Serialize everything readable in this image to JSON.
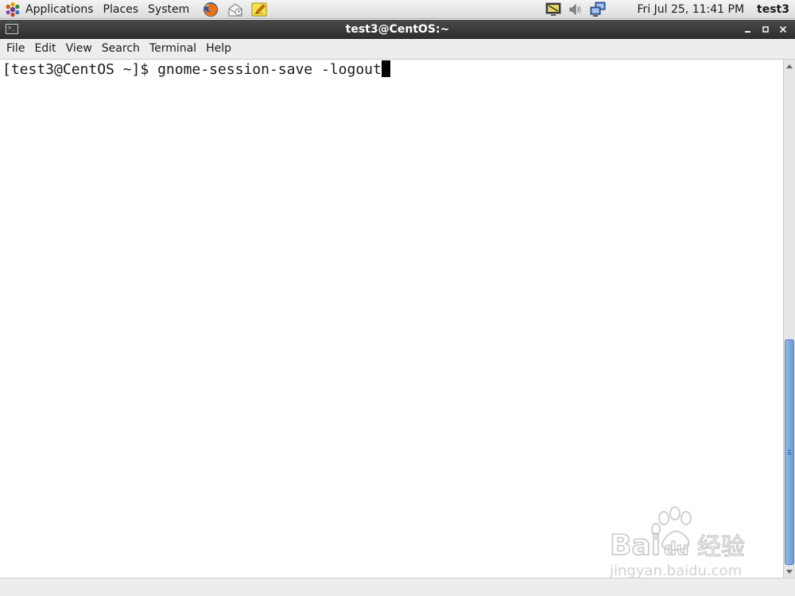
{
  "panel": {
    "menus": [
      "Applications",
      "Places",
      "System"
    ],
    "launchers": [
      "firefox-icon",
      "mail-icon",
      "notes-icon"
    ],
    "tray": [
      "monitor-icon",
      "volume-icon",
      "network-icon"
    ],
    "clock": "Fri Jul 25, 11:41 PM",
    "user": "test3"
  },
  "window": {
    "title": "test3@CentOS:~",
    "controls": [
      "minimize",
      "maximize",
      "close"
    ],
    "menu": [
      "File",
      "Edit",
      "View",
      "Search",
      "Terminal",
      "Help"
    ]
  },
  "terminal": {
    "prompt": "[test3@CentOS ~]$ ",
    "command": "gnome-session-save -logout"
  },
  "scrollbar": {
    "thumb_fraction": 0.44,
    "position": "bottom"
  },
  "watermark": {
    "logo_text": "Bai du 经验",
    "url": "jingyan.baidu.com"
  }
}
